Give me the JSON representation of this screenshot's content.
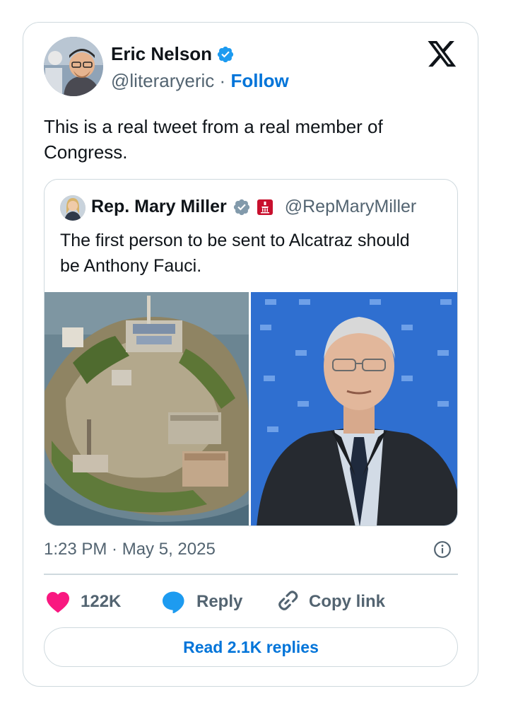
{
  "author": {
    "name": "Eric Nelson",
    "handle": "@literaryeric",
    "separator": "·",
    "follow_label": "Follow",
    "avatar_icon": "avatar-photo",
    "verified_icon": "verified-badge-icon"
  },
  "tweet": {
    "text": "This is a real tweet from a real member of Congress."
  },
  "quoted_tweet": {
    "name": "Rep. Mary Miller",
    "handle": "@RepMaryMiller",
    "text": "The first person to be sent to Alcatraz should be Anthony Fauci.",
    "affiliation_icon": "government-badge-icon"
  },
  "timestamp": "1:23 PM · May 5, 2025",
  "actions": {
    "likes": "122K",
    "reply_label": "Reply",
    "copy_label": "Copy link"
  },
  "read_replies_label": "Read 2.1K replies",
  "colors": {
    "accent": "#0074d9",
    "like": "#f91880",
    "reply": "#1d9bf0",
    "verified": "#1d9bf0",
    "text": "#0f1419",
    "muted": "#536471",
    "border": "#cfd9de"
  }
}
